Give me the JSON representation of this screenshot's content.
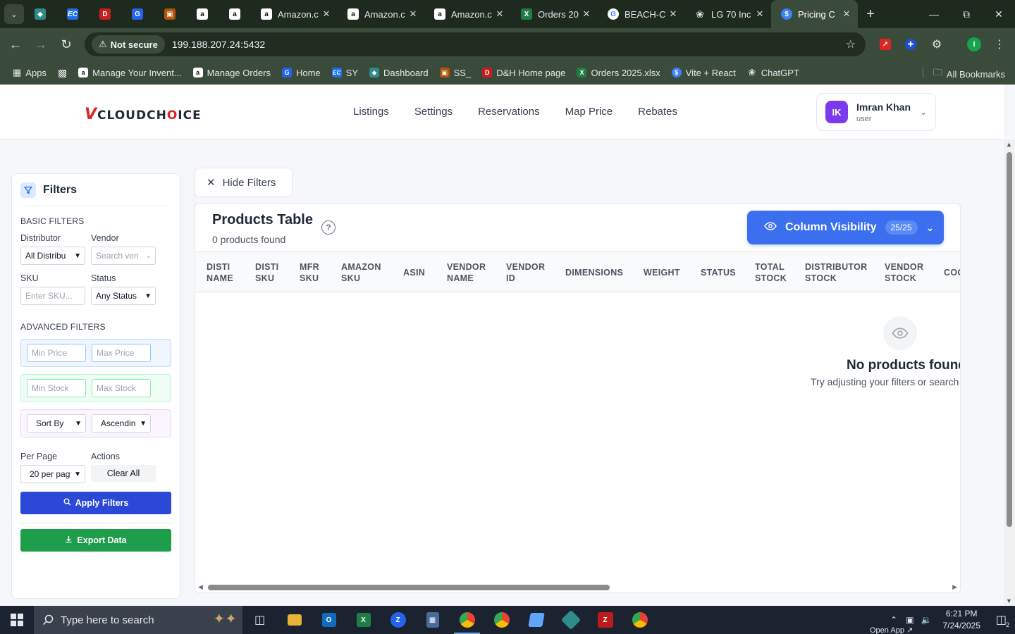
{
  "browser": {
    "tabs": [
      {
        "title": "Amazon.c",
        "icon": "amazon-icon"
      },
      {
        "title": "Amazon.c",
        "icon": "amazon-icon"
      },
      {
        "title": "Amazon.c",
        "icon": "amazon-icon"
      },
      {
        "title": "Orders 20",
        "icon": "excel-icon"
      },
      {
        "title": "BEACH-C",
        "icon": "google-icon"
      },
      {
        "title": "LG 70 Inc",
        "icon": "openai-icon"
      },
      {
        "title": "Pricing C",
        "icon": "pricing-icon"
      }
    ],
    "security_label": "Not secure",
    "url": "199.188.207.24:5432",
    "bookmarks": [
      {
        "label": "Apps"
      },
      {
        "label": "Manage Your Invent..."
      },
      {
        "label": "Manage Orders"
      },
      {
        "label": "Home"
      },
      {
        "label": "SY"
      },
      {
        "label": "Dashboard"
      },
      {
        "label": "SS_"
      },
      {
        "label": "D&H Home page"
      },
      {
        "label": "Orders 2025.xlsx"
      },
      {
        "label": "Vite + React"
      },
      {
        "label": "ChatGPT"
      }
    ],
    "all_bookmarks": "All Bookmarks",
    "profile_initial": "i"
  },
  "app": {
    "logo": {
      "v": "V",
      "a": "CLOUDCH",
      "b": "O",
      "c": "ICE"
    },
    "nav": [
      "Listings",
      "Settings",
      "Reservations",
      "Map Price",
      "Rebates"
    ],
    "user": {
      "initials": "IK",
      "name": "Imran Khan",
      "role": "user"
    }
  },
  "filters": {
    "title": "Filters",
    "basic_title": "BASIC FILTERS",
    "distributor_label": "Distributor",
    "distributor_value": "All Distribu",
    "vendor_label": "Vendor",
    "vendor_placeholder": "Search ven",
    "sku_label": "SKU",
    "sku_placeholder": "Enter SKU...",
    "status_label": "Status",
    "status_value": "Any Status",
    "advanced_title": "ADVANCED FILTERS",
    "min_price": "Min Price",
    "max_price": "Max Price",
    "min_stock": "Min Stock",
    "max_stock": "Max Stock",
    "sort_by": "Sort By",
    "sort_order": "Ascendin",
    "per_page_label": "Per Page",
    "per_page_value": "20 per pag",
    "actions_label": "Actions",
    "clear_all": "Clear All",
    "apply": "Apply Filters",
    "export": "Export Data"
  },
  "hide_filters": "Hide Filters",
  "table": {
    "title": "Products Table",
    "count": "0 products found",
    "column_visibility": "Column Visibility",
    "column_count": "25/25",
    "columns": [
      {
        "l1": "DISTI",
        "l2": "NAME"
      },
      {
        "l1": "DISTI",
        "l2": "SKU"
      },
      {
        "l1": "MFR",
        "l2": "SKU"
      },
      {
        "l1": "AMAZON",
        "l2": "SKU"
      },
      {
        "l1": "ASIN",
        "l2": ""
      },
      {
        "l1": "VENDOR",
        "l2": "NAME"
      },
      {
        "l1": "VENDOR",
        "l2": "ID"
      },
      {
        "l1": "DIMENSIONS",
        "l2": ""
      },
      {
        "l1": "WEIGHT",
        "l2": ""
      },
      {
        "l1": "STATUS",
        "l2": ""
      },
      {
        "l1": "TOTAL",
        "l2": "STOCK"
      },
      {
        "l1": "DISTRIBUTOR",
        "l2": "STOCK"
      },
      {
        "l1": "VENDOR",
        "l2": "STOCK"
      },
      {
        "l1": "COG",
        "l2": ""
      }
    ],
    "empty_title": "No products found",
    "empty_sub": "Try adjusting your filters or search"
  },
  "taskbar": {
    "search_placeholder": "Type here to search",
    "time": "6:21 PM",
    "date": "7/24/2025",
    "open_app": "Open App ↗",
    "notifications": "2"
  }
}
